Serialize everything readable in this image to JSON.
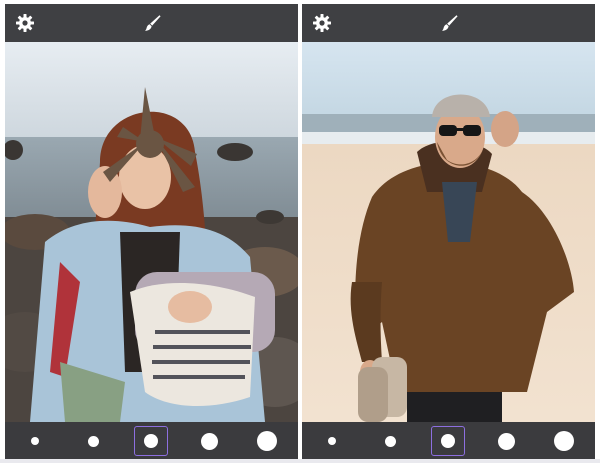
{
  "screens": [
    {
      "toolbar": {
        "left_icon": "gear-icon",
        "center_icon": "paintbrush-icon"
      },
      "photo": {
        "subject": "woman-holding-starfish"
      },
      "brush_sizes": {
        "count": 5,
        "selected_index": 2
      }
    },
    {
      "toolbar": {
        "left_icon": "gear-icon",
        "center_icon": "paintbrush-icon"
      },
      "photo": {
        "subject": "man-on-beach"
      },
      "brush_sizes": {
        "count": 5,
        "selected_index": 2
      }
    }
  ],
  "colors": {
    "toolbar_bg": "#3f4043",
    "bottombar_bg": "#3b3b3e",
    "selection_accent": "#8d6fe0",
    "icon_color": "#ffffff"
  }
}
